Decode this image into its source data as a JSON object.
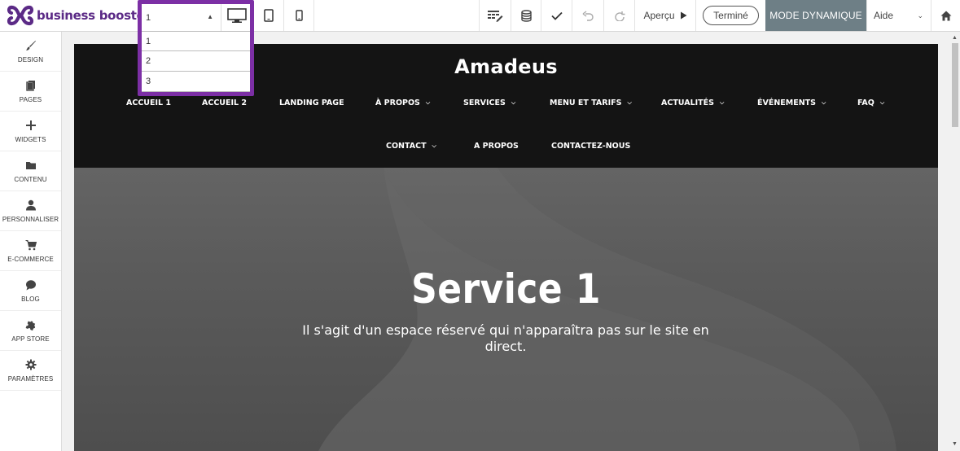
{
  "app": {
    "logo_text": "business booster",
    "brand_color": "#5b2a86",
    "highlight_color": "#7c2fa5"
  },
  "page_select": {
    "selected": "1",
    "options": [
      "1",
      "2",
      "3"
    ]
  },
  "toolbar": {
    "apercu_label": "Aperçu",
    "termine_label": "Terminé",
    "mode_label": "MODE DYNAMIQUE",
    "aide_label": "Aide",
    "mode_color": "#6e7f86"
  },
  "sidebar": {
    "items": [
      {
        "label": "DESIGN",
        "icon": "brush-icon"
      },
      {
        "label": "PAGES",
        "icon": "pages-icon"
      },
      {
        "label": "WIDGETS",
        "icon": "plus-icon"
      },
      {
        "label": "CONTENU",
        "icon": "folder-icon"
      },
      {
        "label": "PERSONNALISER",
        "icon": "user-icon"
      },
      {
        "label": "E-COMMERCE",
        "icon": "cart-icon"
      },
      {
        "label": "BLOG",
        "icon": "chat-icon"
      },
      {
        "label": "APP STORE",
        "icon": "puzzle-icon"
      },
      {
        "label": "PARAMÈTRES",
        "icon": "gear-icon"
      }
    ]
  },
  "site": {
    "title": "Amadeus",
    "nav": [
      {
        "label": "ACCUEIL 1",
        "dropdown": false
      },
      {
        "label": "ACCUEIL 2",
        "dropdown": false
      },
      {
        "label": "LANDING PAGE",
        "dropdown": false
      },
      {
        "label": "À PROPOS",
        "dropdown": true
      },
      {
        "label": "SERVICES",
        "dropdown": true
      },
      {
        "label": "MENU ET TARIFS",
        "dropdown": true
      },
      {
        "label": "ACTUALITÉS",
        "dropdown": true
      },
      {
        "label": "ÉVÉNEMENTS",
        "dropdown": true
      },
      {
        "label": "FAQ",
        "dropdown": true
      },
      {
        "label": "CONTACT",
        "dropdown": true
      },
      {
        "label": "A PROPOS",
        "dropdown": false
      },
      {
        "label": "CONTACTEZ-NOUS",
        "dropdown": false
      }
    ],
    "hero": {
      "title": "Service 1",
      "text": "Il s'agit d'un espace réservé qui n'apparaîtra pas sur le site en direct."
    }
  }
}
